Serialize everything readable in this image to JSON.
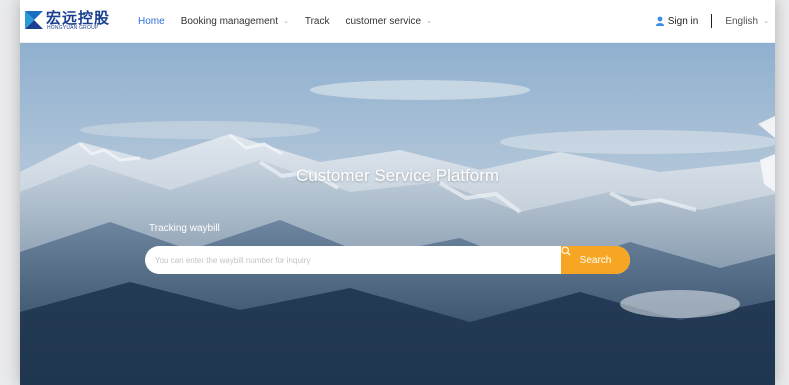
{
  "logo": {
    "text_cn": "宏远控股",
    "text_en": "HONGYUAN GROUP"
  },
  "nav": {
    "home": "Home",
    "booking": "Booking management",
    "track": "Track",
    "service": "customer service"
  },
  "header_right": {
    "sign_in": "Sign in",
    "language": "English"
  },
  "hero": {
    "title": "Customer Service Platform",
    "tracking_label": "Tracking waybill",
    "search_placeholder": "You can enter the waybill number for inquiry",
    "search_button": "Search"
  },
  "colors": {
    "brand": "#1a3f8f",
    "nav_active": "#2f6fd6",
    "search_button": "#f6a623"
  },
  "icons": {
    "logo": "logo-mark-icon",
    "chevron": "chevron-down-icon",
    "user": "user-icon",
    "search": "search-icon"
  }
}
